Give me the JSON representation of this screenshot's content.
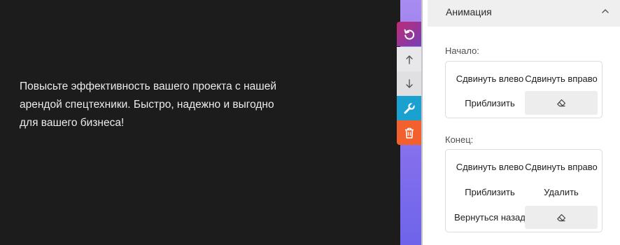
{
  "canvas": {
    "text": "Повысьте эффективность вашего проекта с нашей арендой спецтехники. Быстро, надежно и выгодно для вашего бизнеса!"
  },
  "toolbar": {
    "items": [
      {
        "icon": "undo-icon",
        "color": "#c02a74"
      },
      {
        "icon": "arrow-up-icon",
        "color": "#e8e8ea"
      },
      {
        "icon": "arrow-down-icon",
        "color": "#e0e0e3"
      },
      {
        "icon": "wrench-icon",
        "color": "#1aa1cf"
      },
      {
        "icon": "trash-icon",
        "color": "#f2602e"
      }
    ]
  },
  "animation": {
    "title": "Анимация",
    "start": {
      "label": "Начало:",
      "options": [
        "Сдвинуть влево",
        "Сдвинуть вправо",
        "Приблизить"
      ],
      "clear_icon": "eraser-icon"
    },
    "end": {
      "label": "Конец:",
      "options": [
        "Сдвинуть влево",
        "Сдвинуть вправо",
        "Приблизить",
        "Удалить",
        "Вернуться назад"
      ],
      "clear_icon": "eraser-icon"
    }
  },
  "colors": {
    "canvas_bg": "#1c1c1c",
    "rail_gradient_start": "#a88cf0",
    "rail_gradient_end": "#6e64ea",
    "delete": "#f2602e",
    "settings": "#1aa1cf"
  }
}
